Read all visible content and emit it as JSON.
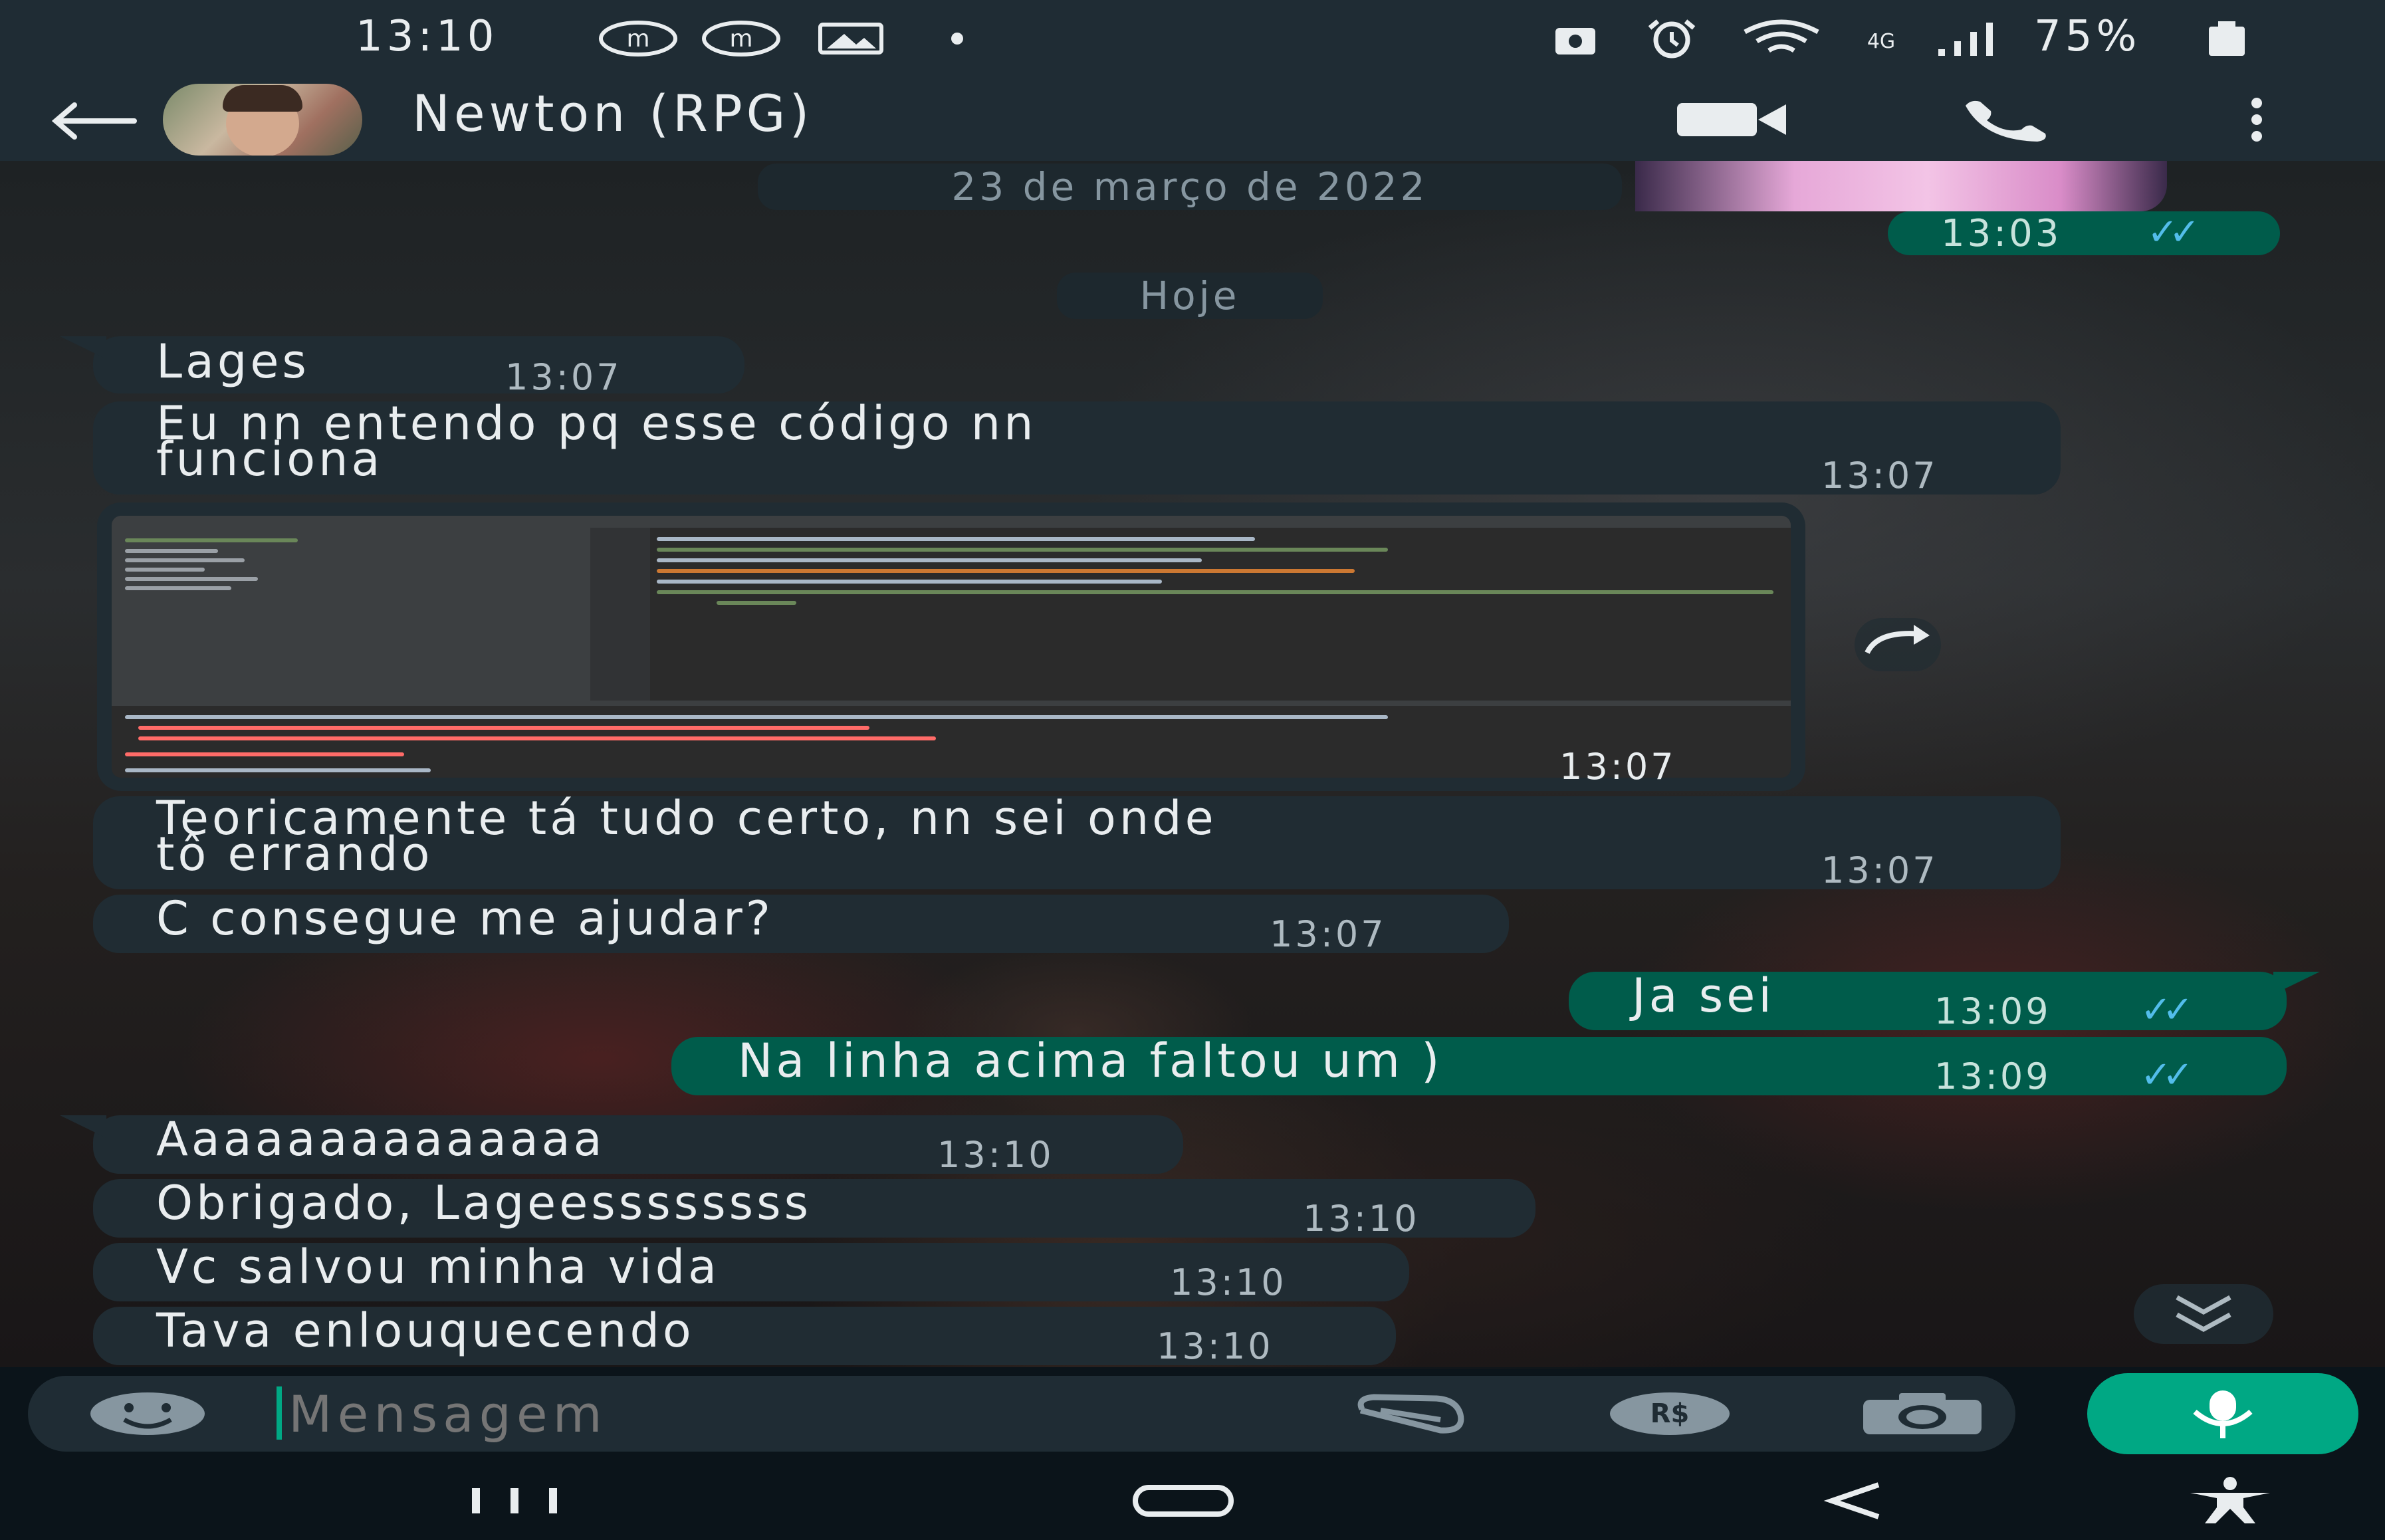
{
  "status_bar": {
    "time": "13:10",
    "battery": "75%",
    "network": "4G",
    "icons": [
      "m-notification-icon",
      "m-notification-icon",
      "gallery-icon",
      "dot-icon",
      "alarm-lock-icon",
      "alarm-icon",
      "wifi-icon",
      "signal-icon",
      "battery-icon"
    ]
  },
  "header": {
    "contact_name": "Newton (RPG)",
    "back_icon": "arrow-left-icon",
    "video_icon": "video-call-icon",
    "call_icon": "phone-icon",
    "menu_icon": "more-vert-icon"
  },
  "chat": {
    "date_pill": "23 de março de 2022",
    "today_pill": "Hoje",
    "prev_out_time": "13:03",
    "messages": [
      {
        "dir": "in",
        "text": "Lages",
        "time": "13:07"
      },
      {
        "dir": "in",
        "text": "Eu nn entendo pq esse código nn\nfunciona",
        "time": "13:07"
      },
      {
        "dir": "in",
        "type": "image",
        "time": "13:07"
      },
      {
        "dir": "in",
        "text": "Teoricamente tá tudo certo, nn sei onde\ntô errando",
        "time": "13:07"
      },
      {
        "dir": "in",
        "text": "C consegue me ajudar?",
        "time": "13:07"
      },
      {
        "dir": "out",
        "text": "Ja sei",
        "time": "13:09"
      },
      {
        "dir": "out",
        "text": "Na linha acima faltou um )",
        "time": "13:09"
      },
      {
        "dir": "in",
        "text": "Aaaaaaaaaaaaaa",
        "time": "13:10"
      },
      {
        "dir": "in",
        "text": "Obrigado, Lageessssssss",
        "time": "13:10"
      },
      {
        "dir": "in",
        "text": "Vc salvou minha vida",
        "time": "13:10"
      },
      {
        "dir": "in",
        "text": "Tava enlouquecendo",
        "time": "13:10"
      }
    ]
  },
  "input": {
    "placeholder": "Mensagem",
    "icons": [
      "emoji-icon",
      "attach-icon",
      "payment-icon",
      "camera-icon",
      "mic-icon"
    ]
  },
  "colors": {
    "incoming_bubble": "#202c33",
    "outgoing_bubble": "#005c4b",
    "accent": "#00a884",
    "read_ticks": "#53bdeb"
  }
}
